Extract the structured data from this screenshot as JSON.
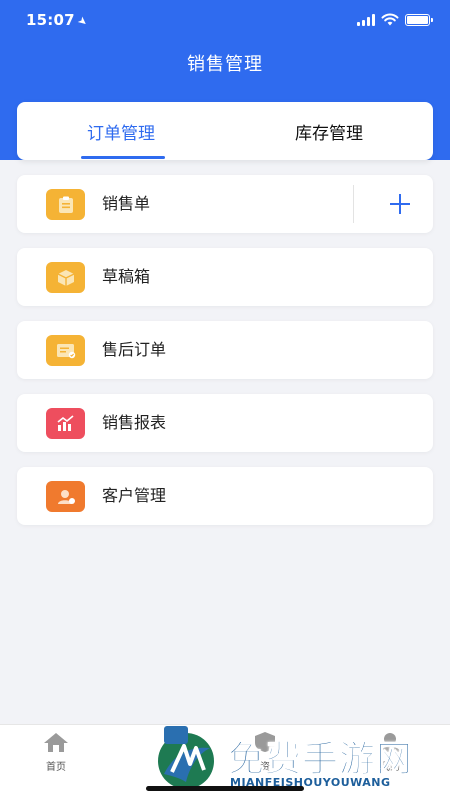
{
  "status_bar": {
    "time": "15:07"
  },
  "header": {
    "title": "销售管理"
  },
  "tabs": [
    {
      "label": "订单管理",
      "active": true
    },
    {
      "label": "库存管理",
      "active": false
    }
  ],
  "menu": [
    {
      "label": "销售单",
      "icon": "clipboard-icon",
      "color": "#f5b335",
      "has_add": true,
      "add_label": "+"
    },
    {
      "label": "草稿箱",
      "icon": "box-icon",
      "color": "#f5b335"
    },
    {
      "label": "售后订单",
      "icon": "receipt-icon",
      "color": "#f5b335"
    },
    {
      "label": "销售报表",
      "icon": "chart-icon",
      "color": "#ee4e5e"
    },
    {
      "label": "客户管理",
      "icon": "customer-icon",
      "color": "#f07a2e"
    }
  ],
  "bottom_nav": [
    {
      "label": "首页",
      "icon": "home-icon"
    },
    {
      "label": "资",
      "icon": "assets-icon"
    },
    {
      "label": "我的",
      "icon": "profile-icon"
    }
  ],
  "watermark": {
    "text": "免费手游网",
    "sub": "MIANFEISHOUYOUWANG"
  },
  "colors": {
    "primary": "#2f6bef",
    "background": "#f2f3f7"
  }
}
